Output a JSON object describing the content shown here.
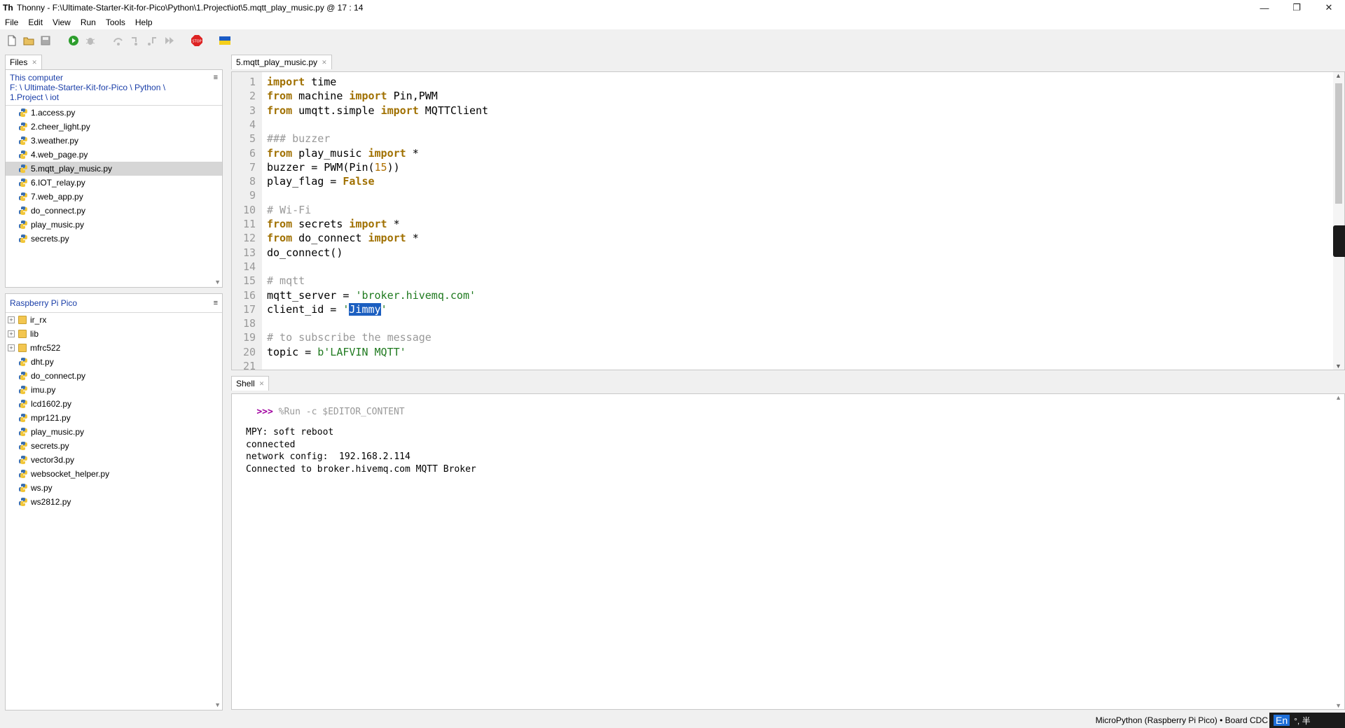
{
  "window": {
    "title": "Thonny  -  F:\\Ultimate-Starter-Kit-for-Pico\\Python\\1.Project\\iot\\5.mqtt_play_music.py  @  17 : 14",
    "app_icon": "Th"
  },
  "menu": [
    "File",
    "Edit",
    "View",
    "Run",
    "Tools",
    "Help"
  ],
  "toolbar_icons": [
    "new-file-icon",
    "open-file-icon",
    "save-icon",
    "run-icon",
    "debug-icon",
    "step-over-icon",
    "step-into-icon",
    "step-out-icon",
    "resume-icon",
    "stop-icon",
    "flag-icon"
  ],
  "files_panel": {
    "tab_label": "Files",
    "this_computer": {
      "header": "This computer",
      "path": "F: \\ Ultimate-Starter-Kit-for-Pico \\ Python \\ 1.Project \\ iot",
      "files": [
        "1.access.py",
        "2.cheer_light.py",
        "3.weather.py",
        "4.web_page.py",
        "5.mqtt_play_music.py",
        "6.IOT_relay.py",
        "7.web_app.py",
        "do_connect.py",
        "play_music.py",
        "secrets.py"
      ],
      "selected": "5.mqtt_play_music.py"
    },
    "pico": {
      "header": "Raspberry Pi Pico",
      "folders": [
        "ir_rx",
        "lib",
        "mfrc522"
      ],
      "files": [
        "dht.py",
        "do_connect.py",
        "imu.py",
        "lcd1602.py",
        "mpr121.py",
        "play_music.py",
        "secrets.py",
        "vector3d.py",
        "websocket_helper.py",
        "ws.py",
        "ws2812.py"
      ]
    }
  },
  "editor": {
    "tab_label": "5.mqtt_play_music.py",
    "lines": [
      "import time",
      "from machine import Pin,PWM",
      "from umqtt.simple import MQTTClient",
      "",
      "### buzzer",
      "from play_music import *",
      "buzzer = PWM(Pin(15))",
      "play_flag = False",
      "",
      "# Wi-Fi",
      "from secrets import *",
      "from do_connect import *",
      "do_connect()",
      "",
      "# mqtt",
      "mqtt_server = 'broker.hivemq.com'",
      "client_id = 'Jimmy'",
      "",
      "# to subscribe the message",
      "topic = b'LAFVIN MQTT'",
      ""
    ]
  },
  "shell": {
    "tab_label": "Shell",
    "prompt": ">>>",
    "command": "%Run -c $EDITOR_CONTENT",
    "output": [
      "MPY: soft reboot",
      "connected",
      "network config:  192.168.2.114",
      "Connected to broker.hivemq.com MQTT Broker"
    ]
  },
  "status": {
    "interpreter": "MicroPython (Raspberry Pi Pico)  •  Board CDC",
    "ime": "En",
    "ime_extra": "°,  半"
  }
}
